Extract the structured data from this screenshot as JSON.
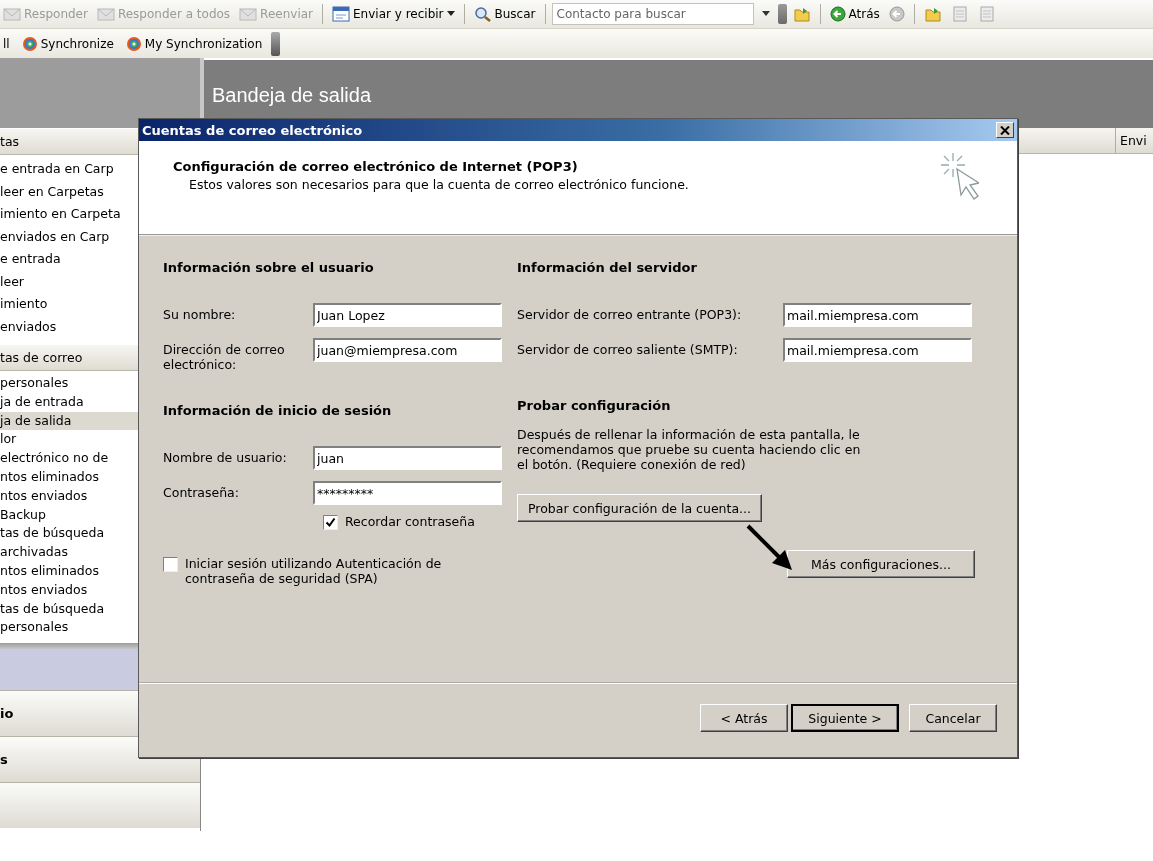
{
  "toolbar": {
    "items": [
      {
        "kind": "button",
        "label": "Responder",
        "disabled": true
      },
      {
        "kind": "button",
        "label": "Responder a todos",
        "disabled": true
      },
      {
        "kind": "button",
        "label": "Reenviar",
        "disabled": true
      },
      {
        "kind": "separator"
      },
      {
        "kind": "menu",
        "label": "Enviar y recibir",
        "disabled": false
      },
      {
        "kind": "separator"
      },
      {
        "kind": "find",
        "label": "Buscar",
        "disabled": false
      },
      {
        "kind": "separator"
      },
      {
        "kind": "search",
        "placeholder": "Contacto para buscar"
      },
      {
        "kind": "grip"
      },
      {
        "kind": "icon",
        "disabled": false
      },
      {
        "kind": "separator"
      },
      {
        "kind": "nav",
        "label": "Atrás",
        "disabled": false
      },
      {
        "kind": "nav",
        "disabled": true
      },
      {
        "kind": "separator"
      },
      {
        "kind": "icon",
        "disabled": false
      },
      {
        "kind": "icon",
        "disabled": true
      },
      {
        "kind": "icon",
        "disabled": true
      }
    ]
  },
  "toolbar_2": {
    "items": [
      {
        "kind": "text",
        "label": "ll"
      },
      {
        "kind": "sync",
        "label": "Synchronize"
      },
      {
        "kind": "sync",
        "label": "My Synchronization"
      },
      {
        "kind": "grip"
      }
    ]
  },
  "pane_title": "Bandeja de salida",
  "sidebar": {
    "sections": [
      {
        "header": "tas",
        "items": [
          {
            "label": "e entrada en Carp",
            "selected": false
          },
          {
            "label": "leer en Carpetas",
            "selected": false
          },
          {
            "label": "imiento en Carpeta",
            "selected": false
          },
          {
            "label": "enviados en Carp",
            "selected": false
          },
          {
            "label": "e entrada",
            "selected": false
          },
          {
            "label": "leer",
            "selected": false
          },
          {
            "label": "imiento",
            "selected": false
          },
          {
            "label": "enviados",
            "selected": false
          }
        ]
      },
      {
        "header": "tas de correo",
        "items": [
          {
            "label": "personales",
            "selected": false
          },
          {
            "label": "ja de entrada",
            "selected": false
          },
          {
            "label": "ja de salida",
            "selected": true
          },
          {
            "label": "lor",
            "selected": false
          },
          {
            "label": "electrónico no de",
            "selected": false
          },
          {
            "label": "ntos eliminados",
            "selected": false
          },
          {
            "label": "ntos enviados",
            "selected": false
          },
          {
            "label": "Backup",
            "selected": false
          },
          {
            "label": "tas de búsqueda",
            "selected": false
          },
          {
            "label": "archivadas",
            "selected": false
          },
          {
            "label": "ntos eliminados",
            "selected": false
          },
          {
            "label": "ntos enviados",
            "selected": false
          },
          {
            "label": "tas de búsqueda",
            "selected": false
          },
          {
            "label": "personales",
            "selected": false
          }
        ]
      }
    ],
    "nav_buttons": [
      {
        "label": "io"
      },
      {
        "label": "s"
      }
    ]
  },
  "table": {
    "columns": [
      "Envi"
    ]
  },
  "dialog": {
    "title": "Cuentas de correo electrónico",
    "header_title": "Configuración de correo electrónico de Internet (POP3)",
    "header_subtitle": "Estos valores son necesarios para que la cuenta de correo electrónico funcione.",
    "user_info": {
      "heading": "Información sobre el usuario",
      "fields": [
        {
          "label": "Su nombre:",
          "value": "Juan Lopez"
        },
        {
          "label": "Dirección de correo electrónico:",
          "value": "juan@miempresa.com"
        }
      ]
    },
    "login_info": {
      "heading": "Información de inicio de sesión",
      "fields": [
        {
          "label": "Nombre de usuario:",
          "value": "juan"
        },
        {
          "label": "Contraseña:",
          "value": "*********"
        }
      ],
      "remember": {
        "label": "Recordar contraseña",
        "checked": true
      },
      "spa": {
        "label": "Iniciar sesión utilizando Autenticación de contraseña de seguridad (SPA)",
        "checked": false
      }
    },
    "server_info": {
      "heading": "Información del servidor",
      "fields": [
        {
          "label": "Servidor de correo entrante (POP3):",
          "value": "mail.miempresa.com"
        },
        {
          "label": "Servidor de correo saliente (SMTP):",
          "value": "mail.miempresa.com"
        }
      ]
    },
    "test": {
      "heading": "Probar configuración",
      "text": "Después de rellenar la información de esta pantalla, le recomendamos que pruebe su cuenta haciendo clic en el botón. (Requiere conexión de red)",
      "button": "Probar configuración de la cuenta...",
      "more_button": "Más configuraciones..."
    },
    "buttons": [
      {
        "label": "< Atrás",
        "default": false
      },
      {
        "label": "Siguiente >",
        "default": true
      },
      {
        "label": "Cancelar",
        "default": false
      }
    ]
  }
}
